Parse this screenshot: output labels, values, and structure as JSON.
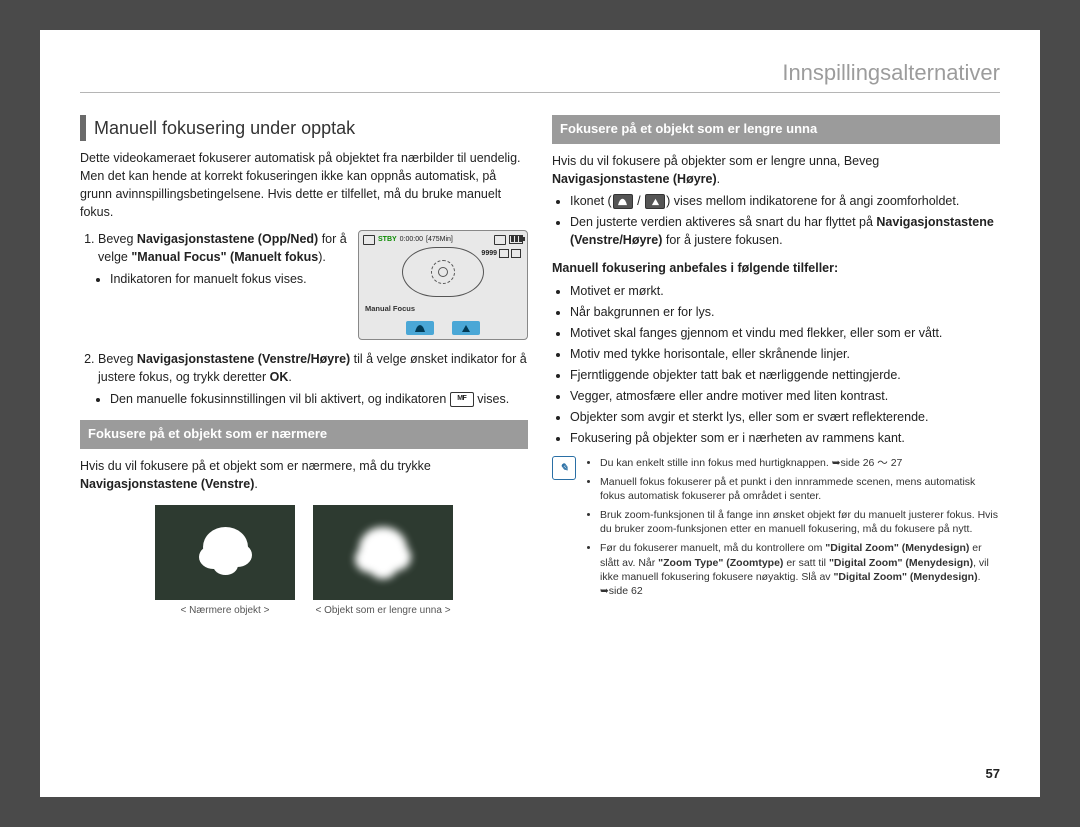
{
  "header": "Innspillingsalternativer",
  "pageNumber": "57",
  "left": {
    "sectionTitle": "Manuell fokusering under opptak",
    "intro": "Dette videokameraet fokuserer automatisk på objektet fra nærbilder til uendelig. Men det kan hende at korrekt fokuseringen ikke kan oppnås automatisk, på grunn avinnspillingsbetingelsene. Hvis dette er tilfellet, må du bruke manuelt fokus.",
    "step1_a": "Beveg ",
    "step1_b": "Navigasjonstastene (Opp/Ned)",
    "step1_c": " for å velge ",
    "step1_d": "\"Manual Focus\" (Manuelt fokus",
    "step1_e": ").",
    "step1_sub": "Indikatoren for manuelt fokus vises.",
    "step2_a": "Beveg ",
    "step2_b": "Navigasjonstastene (Venstre/Høyre)",
    "step2_c": " til å velge ønsket indikator for å justere fokus, og trykk deretter ",
    "step2_d": "OK",
    "step2_e": ".",
    "step2_sub_a": "Den manuelle fokusinnstillingen vil bli aktivert, og indikatoren ",
    "step2_sub_b": " vises.",
    "banner1": "Fokusere på et objekt som er nærmere",
    "near_a": "Hvis du vil fokusere på et objekt som er nærmere, må du trykke ",
    "near_b": "Navigasjonstastene (Venstre)",
    "near_c": ".",
    "thumb1": "< Nærmere objekt >",
    "thumb2": "< Objekt som er lengre unna >",
    "lcd": {
      "stby": "STBY",
      "time": "0:00:00",
      "remain": "[475Min]",
      "count": "9999",
      "label": "Manual Focus"
    }
  },
  "right": {
    "banner2": "Fokusere på et objekt som er lengre unna",
    "far_a": "Hvis du vil fokusere på objekter som er lengre unna, Beveg ",
    "far_b": "Navigasjonstastene (Høyre)",
    "far_c": ".",
    "icon_line_a": "Ikonet (",
    "icon_line_b": " / ",
    "icon_line_c": ") vises mellom indikatorene for å angi zoomforholdet.",
    "adj_a": "Den justerte verdien aktiveres så snart du har flyttet på ",
    "adj_b": "Navigasjonstastene (Venstre/Høyre)",
    "adj_c": " for å justere fokusen.",
    "recTitle": "Manuell fokusering anbefales i følgende tilfeller:",
    "recs": [
      "Motivet er mørkt.",
      "Når bakgrunnen er for lys.",
      "Motivet skal fanges gjennom et vindu med flekker, eller som er vått.",
      "Motiv med tykke horisontale, eller skrånende linjer.",
      "Fjerntliggende objekter tatt bak et nærliggende nettingjerde.",
      "Vegger, atmosfære eller andre motiver med liten kontrast.",
      "Objekter som avgir et sterkt lys, eller som er svært reflekterende.",
      "Fokusering på objekter som er i nærheten av rammens kant."
    ],
    "note1": "Du kan enkelt stille inn fokus med hurtigknappen. ➥side 26 ～ 27",
    "note2": "Manuell fokus fokuserer på et punkt i den innrammede scenen, mens automatisk fokus automatisk fokuserer på området i senter.",
    "note3": "Bruk zoom-funksjonen til å fange inn ønsket objekt før du manuelt justerer fokus. Hvis du bruker zoom-funksjonen etter en manuell fokusering, må du fokusere på nytt.",
    "note4_a": "Før du fokuserer manuelt, må du kontrollere om ",
    "note4_b": "\"Digital Zoom\" (Menydesign)",
    "note4_c": " er slått av. Når ",
    "note4_d": "\"Zoom Type\" (Zoomtype)",
    "note4_e": " er satt til ",
    "note4_f": "\"Digital Zoom\" (Menydesign)",
    "note4_g": ", vil ikke manuell fokusering fokusere nøyaktig. Slå av ",
    "note4_h": "\"Digital Zoom\" (Menydesign)",
    "note4_i": ". ➥side 62"
  }
}
